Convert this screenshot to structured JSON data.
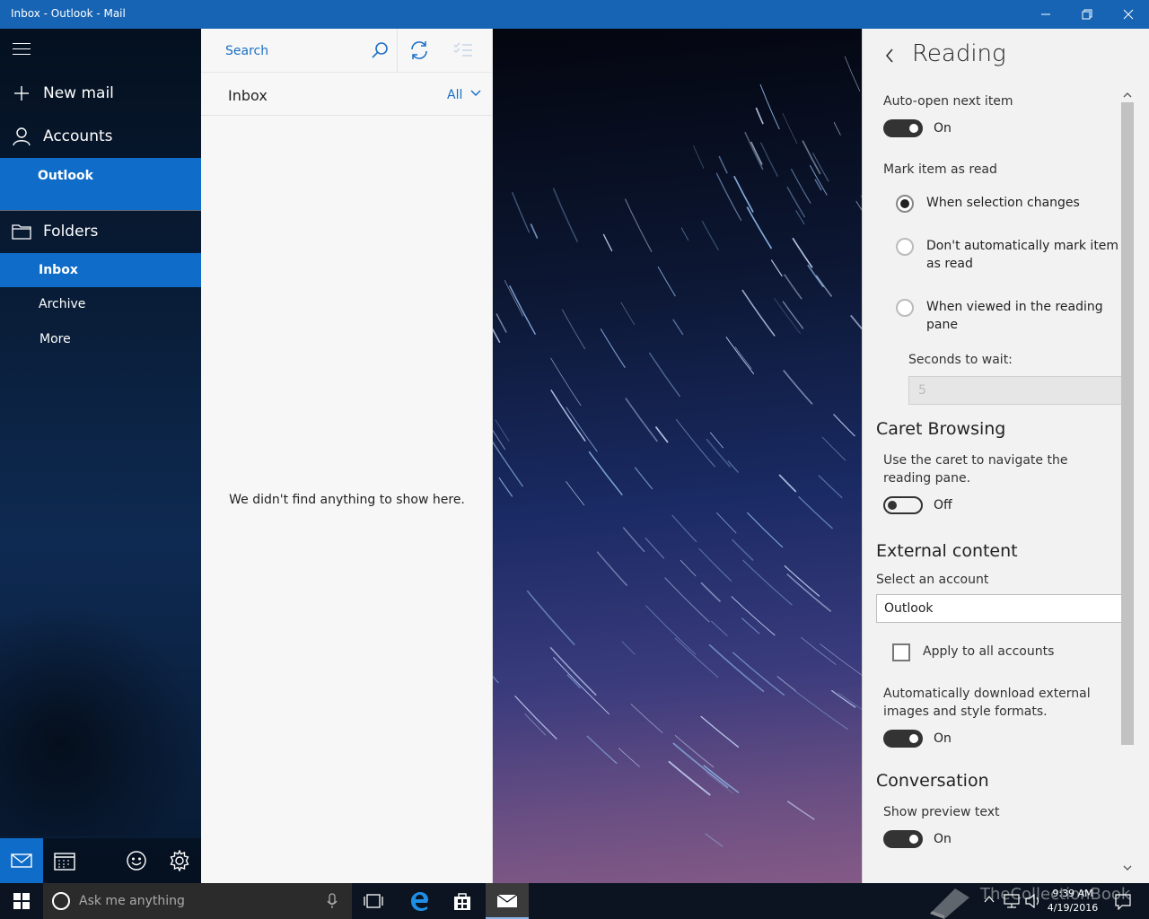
{
  "window": {
    "title": "Inbox - Outlook - Mail"
  },
  "nav": {
    "new_mail": "New mail",
    "accounts": "Accounts",
    "account_name": "Outlook",
    "folders": "Folders",
    "folder_items": [
      "Inbox",
      "Archive",
      "More"
    ]
  },
  "list": {
    "search_placeholder": "Search",
    "header": "Inbox",
    "filter": "All",
    "empty_message": "We didn't find anything to show here."
  },
  "settings": {
    "title": "Reading",
    "auto_open_label": "Auto-open next item",
    "auto_open_value": "On",
    "mark_read_label": "Mark item as read",
    "radio_options": [
      "When selection changes",
      "Don't automatically mark item as read",
      "When viewed in the reading pane"
    ],
    "seconds_label": "Seconds to wait:",
    "seconds_value": "5",
    "caret_heading": "Caret Browsing",
    "caret_desc": "Use the caret to navigate the reading pane.",
    "caret_value": "Off",
    "external_heading": "External content",
    "select_account_label": "Select an account",
    "select_account_value": "Outlook",
    "apply_all_label": "Apply to all accounts",
    "auto_download_label": "Automatically download external images and style formats.",
    "auto_download_value": "On",
    "conversation_heading": "Conversation",
    "preview_label": "Show preview text",
    "preview_value": "On"
  },
  "taskbar": {
    "search_placeholder": "Ask me anything",
    "time": "9:39 AM",
    "date": "4/19/2016",
    "watermark": "TheCollectionBook"
  },
  "colors": {
    "accent": "#0f6cc8",
    "titlebar": "#1764b4",
    "link": "#1a6fc5"
  }
}
